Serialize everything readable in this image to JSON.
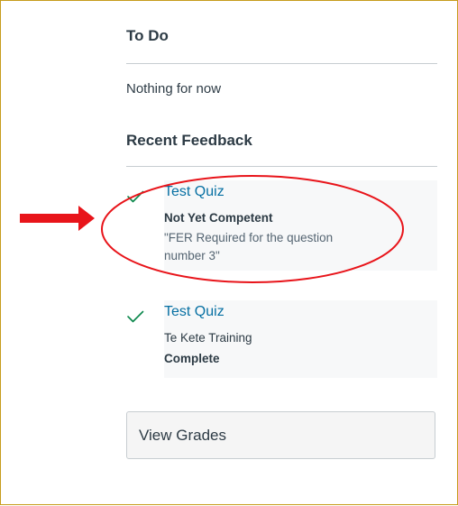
{
  "todo": {
    "title": "To Do",
    "empty_text": "Nothing for now"
  },
  "recent_feedback": {
    "title": "Recent Feedback",
    "items": [
      {
        "link": "Test Quiz",
        "line1": "Not Yet Competent",
        "line2": "\"FER Required for the question",
        "line3": "number 3\"",
        "icon": "checkmark-icon"
      },
      {
        "link": "Test Quiz",
        "line1": "Te Kete Training",
        "line2": "Complete",
        "icon": "checkmark-icon"
      }
    ]
  },
  "buttons": {
    "view_grades": "View Grades"
  },
  "annotation": {
    "arrow_color": "#e8141a",
    "ellipse_color": "#e8141a"
  },
  "colors": {
    "link": "#0770a3",
    "check": "#0b874b",
    "border_frame": "#c69c1b"
  }
}
